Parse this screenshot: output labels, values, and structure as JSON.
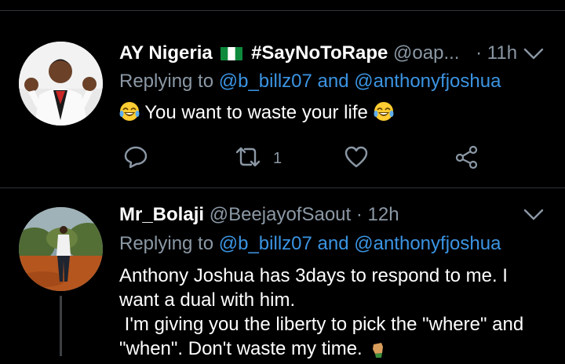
{
  "tweets": [
    {
      "display_name": "AY Nigeria",
      "hashtag": "#SayNoToRape",
      "handle": "@oap...",
      "time": "· 11h",
      "replying_prefix": "Replying to",
      "mention_1": "@b_billz07",
      "and_word": "and",
      "mention_2": "@anthonyfjoshua",
      "text": "You want to waste your life",
      "retweet_count": "1"
    },
    {
      "display_name": "Mr_Bolaji",
      "handle": "@BeejayofSaout",
      "time": "· 12h",
      "replying_prefix": "Replying to",
      "mention_1": "@b_billz07",
      "and_word": "and",
      "mention_2": "@anthonyfjoshua",
      "text_line_1": "Anthony Joshua has 3days to respond to me. I",
      "text_line_2": "want a dual with him.",
      "text_line_3": " I'm giving you the liberty to pick the \"where\" and",
      "text_line_4": "\"when\". Don't waste my time."
    }
  ],
  "icons": [
    "laughing-emoji",
    "flag-nigeria",
    "chevron-down",
    "reply",
    "retweet",
    "like",
    "share",
    "fist-emoji"
  ],
  "colors": {
    "background": "#000000",
    "link": "#3b94e2",
    "muted": "#8b98a5",
    "divider": "#2f3336"
  }
}
